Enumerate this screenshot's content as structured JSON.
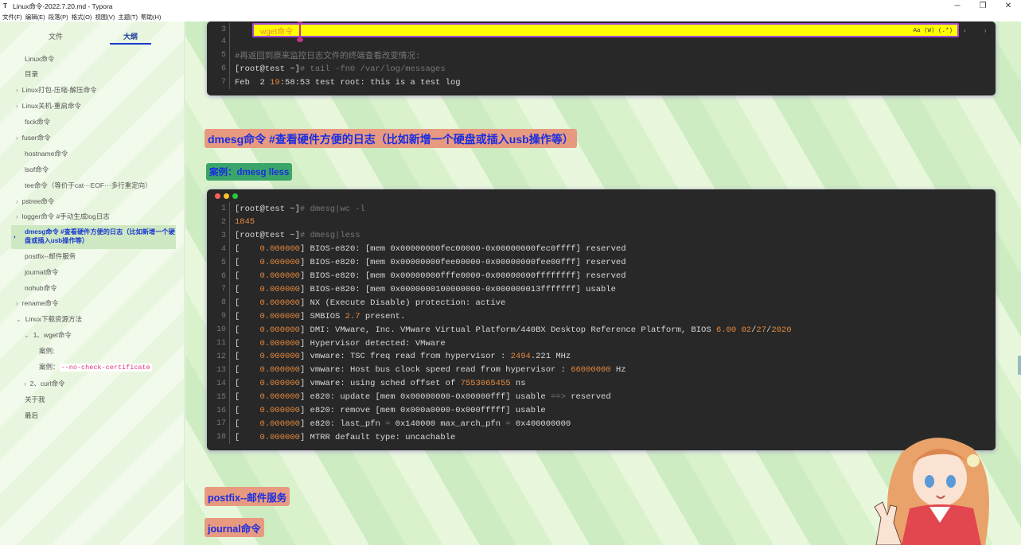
{
  "window": {
    "title": "Linux命令-2022.7.20.md - Typora",
    "controls": [
      "─",
      "❐",
      "✕"
    ]
  },
  "menu": [
    "文件(F)",
    "编辑(E)",
    "段落(P)",
    "格式(O)",
    "视图(V)",
    "主题(T)",
    "帮助(H)"
  ],
  "sidebar": {
    "tabs": {
      "files": "文件",
      "outline": "大纲"
    },
    "items": [
      {
        "label": "Linux命令",
        "caret": ""
      },
      {
        "label": "目录",
        "caret": ""
      },
      {
        "label": "Linux打包-压缩-解压命令",
        "caret": "›"
      },
      {
        "label": "Linux关机-重启命令",
        "caret": "›"
      },
      {
        "label": "fsck命令",
        "caret": ""
      },
      {
        "label": "fuser命令",
        "caret": "›"
      },
      {
        "label": "hostname命令",
        "caret": ""
      },
      {
        "label": "lsof命令",
        "caret": ""
      },
      {
        "label": "tee命令（等价于cat···EOF···多行重定向）",
        "caret": ""
      },
      {
        "label": "pstree命令",
        "caret": "›"
      },
      {
        "label": "logger命令 #手动生成log日志",
        "caret": "›"
      },
      {
        "label": "dmesg命令 #查看硬件方便的日志（比如新增一个硬盘或插入usb操作等）",
        "caret": "›"
      },
      {
        "label": "postfix--邮件服务",
        "caret": ""
      },
      {
        "label": "journal命令",
        "caret": ""
      },
      {
        "label": "nohub命令",
        "caret": ""
      },
      {
        "label": "rename命令",
        "caret": "›"
      },
      {
        "label": "Linux下载资源方法",
        "caret": "⌄"
      },
      {
        "label": "1、wget命令",
        "caret": "⌄"
      },
      {
        "label": "案例:",
        "caret": ""
      },
      {
        "label": "案例：",
        "code": "--no-check-certificate",
        "caret": ""
      },
      {
        "label": "2、curl命令",
        "caret": "›"
      },
      {
        "label": "关于我",
        "caret": ""
      },
      {
        "label": "最后",
        "caret": ""
      }
    ]
  },
  "find": {
    "query": "wget命令",
    "options": "Aa  ⟨W⟩  (.*)",
    "close": "×"
  },
  "code_block_1": {
    "lines": [
      {
        "n": "3",
        "parts": []
      },
      {
        "n": "4",
        "parts": []
      },
      {
        "n": "5",
        "parts": [
          {
            "t": "#再返回到原来监控日志文件的终端查看改变情况:",
            "c": "dim"
          }
        ]
      },
      {
        "n": "6",
        "parts": [
          {
            "t": "[root@test ~]",
            "c": ""
          },
          {
            "t": "# tail -fn0 /var/log/messages",
            "c": "dim"
          }
        ]
      },
      {
        "n": "7",
        "parts": [
          {
            "t": "Feb  2 ",
            "c": ""
          },
          {
            "t": "19",
            "c": "num"
          },
          {
            "t": ":58:53 test root: this is a test log",
            "c": ""
          }
        ]
      }
    ]
  },
  "headings": {
    "dmesg": "dmesg命令 #查看硬件方便的日志（比如新增一个硬盘或插入usb操作等）",
    "case": "案例：dmesg lless",
    "postfix": "postfix--邮件服务",
    "journal": "journal命令"
  },
  "code_block_2": {
    "lines": [
      {
        "n": "1",
        "parts": [
          {
            "t": "[root@test ~]",
            "c": ""
          },
          {
            "t": "# dmesg|wc -l",
            "c": "dim"
          }
        ]
      },
      {
        "n": "2",
        "parts": [
          {
            "t": "1845",
            "c": "num"
          }
        ]
      },
      {
        "n": "3",
        "parts": [
          {
            "t": "[root@test ~]",
            "c": ""
          },
          {
            "t": "# dmesg|less",
            "c": "dim"
          }
        ]
      },
      {
        "n": "4",
        "parts": [
          {
            "t": "[    ",
            "c": ""
          },
          {
            "t": "0.000000",
            "c": "num"
          },
          {
            "t": "] BIOS-e820: [mem 0x00000000fec00000-0x00000000fec0ffff] reserved",
            "c": ""
          }
        ]
      },
      {
        "n": "5",
        "parts": [
          {
            "t": "[    ",
            "c": ""
          },
          {
            "t": "0.000000",
            "c": "num"
          },
          {
            "t": "] BIOS-e820: [mem 0x00000000fee00000-0x00000000fee00fff] reserved",
            "c": ""
          }
        ]
      },
      {
        "n": "6",
        "parts": [
          {
            "t": "[    ",
            "c": ""
          },
          {
            "t": "0.000000",
            "c": "num"
          },
          {
            "t": "] BIOS-e820: [mem 0x00000000fffe0000-0x00000000ffffffff] reserved",
            "c": ""
          }
        ]
      },
      {
        "n": "7",
        "parts": [
          {
            "t": "[    ",
            "c": ""
          },
          {
            "t": "0.000000",
            "c": "num"
          },
          {
            "t": "] BIOS-e820: [mem 0x0000000100000000-0x000000013fffffff] usable",
            "c": ""
          }
        ]
      },
      {
        "n": "8",
        "parts": [
          {
            "t": "[    ",
            "c": ""
          },
          {
            "t": "0.000000",
            "c": "num"
          },
          {
            "t": "] NX (Execute Disable) protection: active",
            "c": ""
          }
        ]
      },
      {
        "n": "9",
        "parts": [
          {
            "t": "[    ",
            "c": ""
          },
          {
            "t": "0.000000",
            "c": "num"
          },
          {
            "t": "] SMBIOS ",
            "c": ""
          },
          {
            "t": "2.7",
            "c": "num"
          },
          {
            "t": " present.",
            "c": ""
          }
        ]
      },
      {
        "n": "10",
        "parts": [
          {
            "t": "[    ",
            "c": ""
          },
          {
            "t": "0.000000",
            "c": "num"
          },
          {
            "t": "] DMI: VMware, Inc. VMware Virtual Platform/440BX Desktop Reference Platform, BIOS ",
            "c": ""
          },
          {
            "t": "6.00",
            "c": "num"
          },
          {
            "t": " ",
            "c": ""
          },
          {
            "t": "02",
            "c": "num"
          },
          {
            "t": "/",
            "c": ""
          },
          {
            "t": "27",
            "c": "num"
          },
          {
            "t": "/",
            "c": ""
          },
          {
            "t": "2020",
            "c": "num"
          }
        ]
      },
      {
        "n": "11",
        "parts": [
          {
            "t": "[    ",
            "c": ""
          },
          {
            "t": "0.000000",
            "c": "num"
          },
          {
            "t": "] Hypervisor detected: VMware",
            "c": ""
          }
        ]
      },
      {
        "n": "12",
        "parts": [
          {
            "t": "[    ",
            "c": ""
          },
          {
            "t": "0.000000",
            "c": "num"
          },
          {
            "t": "] vmware: TSC freq read from hypervisor : ",
            "c": ""
          },
          {
            "t": "2494",
            "c": "num"
          },
          {
            "t": ".221 MHz",
            "c": ""
          }
        ]
      },
      {
        "n": "13",
        "parts": [
          {
            "t": "[    ",
            "c": ""
          },
          {
            "t": "0.000000",
            "c": "num"
          },
          {
            "t": "] vmware: Host bus clock speed read from hypervisor : ",
            "c": ""
          },
          {
            "t": "66000000",
            "c": "num"
          },
          {
            "t": " Hz",
            "c": ""
          }
        ]
      },
      {
        "n": "14",
        "parts": [
          {
            "t": "[    ",
            "c": ""
          },
          {
            "t": "0.000000",
            "c": "num"
          },
          {
            "t": "] vmware: using sched offset of ",
            "c": ""
          },
          {
            "t": "7553065455",
            "c": "num"
          },
          {
            "t": " ns",
            "c": ""
          }
        ]
      },
      {
        "n": "15",
        "parts": [
          {
            "t": "[    ",
            "c": ""
          },
          {
            "t": "0.000000",
            "c": "num"
          },
          {
            "t": "] e820: update [mem 0x00000000-0x00000fff] usable ",
            "c": ""
          },
          {
            "t": "==>",
            "c": "dim"
          },
          {
            "t": " reserved",
            "c": ""
          }
        ]
      },
      {
        "n": "16",
        "parts": [
          {
            "t": "[    ",
            "c": ""
          },
          {
            "t": "0.000000",
            "c": "num"
          },
          {
            "t": "] e820: remove [mem 0x000a0000-0x000fffff] usable",
            "c": ""
          }
        ]
      },
      {
        "n": "17",
        "parts": [
          {
            "t": "[    ",
            "c": ""
          },
          {
            "t": "0.000000",
            "c": "num"
          },
          {
            "t": "] e820: last_pfn ",
            "c": ""
          },
          {
            "t": "=",
            "c": "dim"
          },
          {
            "t": " 0x140000 max_arch_pfn ",
            "c": ""
          },
          {
            "t": "=",
            "c": "dim"
          },
          {
            "t": " 0x400000000",
            "c": ""
          }
        ]
      },
      {
        "n": "18",
        "parts": [
          {
            "t": "[    ",
            "c": ""
          },
          {
            "t": "0.000000",
            "c": "num"
          },
          {
            "t": "] MTRR default type: uncachable",
            "c": ""
          }
        ]
      }
    ]
  },
  "colors": {
    "mac_dots": [
      "#ff5f56",
      "#ffbd2e",
      "#27c93f"
    ],
    "heading_bg": "#e89a80",
    "heading_text": "#1a2ee0",
    "case_bg": "#3aa56a",
    "find_bg": "#ffff00",
    "find_border": "#a64bd6"
  }
}
